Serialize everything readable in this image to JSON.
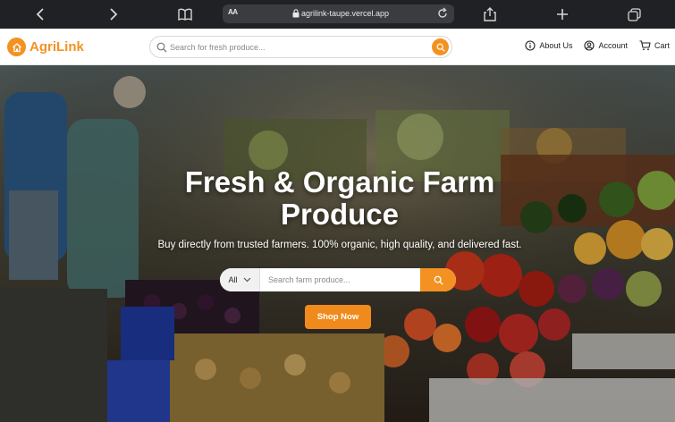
{
  "browser": {
    "text_size_label": "AA",
    "url": "agrilink-taupe.vercel.app"
  },
  "header": {
    "brand": "AgriLink",
    "search_placeholder": "Search for fresh produce...",
    "nav": {
      "about": "About Us",
      "account": "Account",
      "cart": "Cart"
    }
  },
  "hero": {
    "title": "Fresh & Organic Farm Produce",
    "subtitle": "Buy directly from trusted farmers. 100% organic, high quality, and delivered fast.",
    "category_selected": "All",
    "search_placeholder": "Search farm produce...",
    "cta": "Shop Now"
  },
  "colors": {
    "accent": "#f39222",
    "chrome": "#1f2124"
  }
}
